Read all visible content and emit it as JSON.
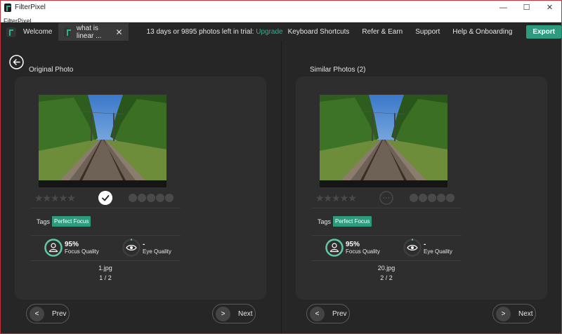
{
  "window": {
    "title": "FilterPixel",
    "minimize": "—",
    "maximize": "☐",
    "close": "✕"
  },
  "menubar": {
    "label": "FilterPixel"
  },
  "tabs": [
    {
      "label": "Welcome"
    },
    {
      "label": "what is linear ...",
      "close": "✕"
    }
  ],
  "trial": {
    "text": "13 days or 9895 photos left in trial:",
    "upgrade": "Upgrade"
  },
  "nav": [
    {
      "label": "Keyboard Shortcuts"
    },
    {
      "label": "Refer & Earn"
    },
    {
      "label": "Support"
    },
    {
      "label": "Help & Onboarding"
    }
  ],
  "export_label": "Export",
  "original": {
    "title": "Original Photo",
    "tags_label": "Tags",
    "tag": "Perfect Focus",
    "stars": "★★★★★",
    "focus": {
      "value": "95%",
      "label": "Focus Quality",
      "fraction": 0.95
    },
    "eye": {
      "value": "-",
      "label": "Eye Quality"
    },
    "file": "1.jpg",
    "index": "1 / 2",
    "prev_label": "Prev",
    "next_label": "Next"
  },
  "similar": {
    "title": "Similar Photos (2)",
    "tags_label": "Tags",
    "tag": "Perfect Focus",
    "stars": "★★★★★",
    "focus": {
      "value": "95%",
      "label": "Focus Quality",
      "fraction": 0.95
    },
    "eye": {
      "value": "-",
      "label": "Eye Quality"
    },
    "file": "20.jpg",
    "index": "2 / 2",
    "prev_label": "Prev",
    "next_label": "Next"
  },
  "colors": {
    "accent": "#2d9c7e",
    "ring": "#5fc8a9",
    "border": "#c4323a"
  }
}
